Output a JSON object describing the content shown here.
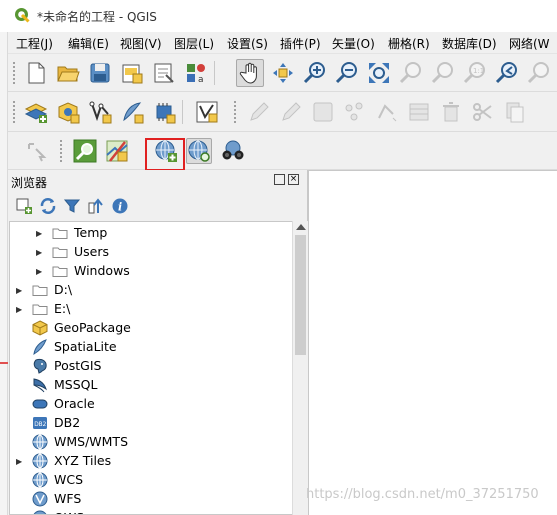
{
  "window": {
    "title": "*未命名的工程 - QGIS"
  },
  "menubar": {
    "items": [
      "工程(J)",
      "编辑(E)",
      "视图(V)",
      "图层(L)",
      "设置(S)",
      "插件(P)",
      "矢量(O)",
      "栅格(R)",
      "数据库(D)",
      "网络(W"
    ]
  },
  "toolbars": {
    "row1_icons": [
      "new-project-icon",
      "open-project-icon",
      "save-project-icon",
      "new-print-layout-icon",
      "layout-manager-icon",
      "style-manager-icon",
      "pan-icon",
      "pan-to-selection-icon",
      "zoom-in-icon",
      "zoom-out-icon",
      "zoom-full-icon",
      "zoom-to-selection-icon",
      "zoom-to-layer-icon",
      "zoom-native-icon",
      "zoom-last-icon",
      "zoom-next-icon"
    ],
    "row2_icons": [
      "data-source-manager-icon",
      "new-geopackage-layer-icon",
      "new-shapefile-layer-icon",
      "new-spatialite-layer-icon",
      "new-temporary-layer-icon",
      "digitize-icon"
    ],
    "row3_icons": [
      "identify-icon",
      "search-icon",
      "metasearch-icon",
      "add-wms-icon",
      "add-wfs-icon",
      "binoculars-icon"
    ]
  },
  "browser": {
    "title": "浏览器",
    "float_label": "□",
    "close_label": "×",
    "toolbar_icons": [
      "add-selected-layers-icon",
      "refresh-icon",
      "filter-icon",
      "collapse-all-icon",
      "info-icon"
    ],
    "items": [
      {
        "label": "Temp",
        "icon": "folder-icon",
        "expandable": true,
        "indent": 1
      },
      {
        "label": "Users",
        "icon": "folder-icon",
        "expandable": true,
        "indent": 1
      },
      {
        "label": "Windows",
        "icon": "folder-icon",
        "expandable": true,
        "indent": 1
      },
      {
        "label": "D:\\",
        "icon": "folder-icon",
        "expandable": true,
        "indent": 0
      },
      {
        "label": "E:\\",
        "icon": "folder-icon",
        "expandable": true,
        "indent": 0
      },
      {
        "label": "GeoPackage",
        "icon": "geopackage-icon",
        "expandable": false,
        "indent": 0
      },
      {
        "label": "SpatiaLite",
        "icon": "spatialite-icon",
        "expandable": false,
        "indent": 0
      },
      {
        "label": "PostGIS",
        "icon": "postgis-icon",
        "expandable": false,
        "indent": 0
      },
      {
        "label": "MSSQL",
        "icon": "mssql-icon",
        "expandable": false,
        "indent": 0
      },
      {
        "label": "Oracle",
        "icon": "oracle-icon",
        "expandable": false,
        "indent": 0
      },
      {
        "label": "DB2",
        "icon": "db2-icon",
        "expandable": false,
        "indent": 0
      },
      {
        "label": "WMS/WMTS",
        "icon": "wms-icon",
        "expandable": false,
        "indent": 0
      },
      {
        "label": "XYZ Tiles",
        "icon": "xyz-icon",
        "expandable": true,
        "indent": 0
      },
      {
        "label": "WCS",
        "icon": "wcs-icon",
        "expandable": false,
        "indent": 0
      },
      {
        "label": "WFS",
        "icon": "wfs-icon",
        "expandable": false,
        "indent": 0
      },
      {
        "label": "OWS",
        "icon": "ows-icon",
        "expandable": false,
        "indent": 0
      }
    ]
  },
  "db2_badge": "DB2",
  "watermark": "https://blog.csdn.net/m0_37251750",
  "colors": {
    "accent_green": "#589632",
    "highlight_red": "#e02020",
    "folder_gray": "#8a8a8a"
  }
}
